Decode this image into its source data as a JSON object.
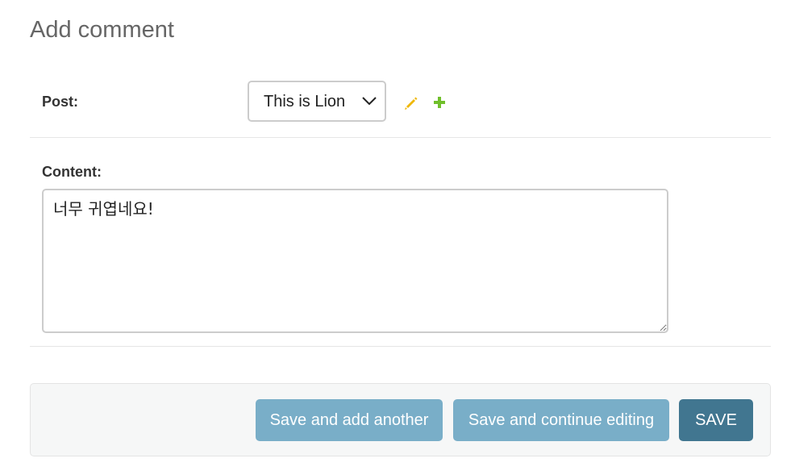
{
  "page": {
    "title": "Add comment"
  },
  "form": {
    "post": {
      "label": "Post:",
      "selected": "This is Lion",
      "edit_icon": "pencil-icon",
      "add_icon": "plus-icon"
    },
    "content": {
      "label": "Content:",
      "value": "너무 귀엽네요!"
    }
  },
  "submit_row": {
    "save_add_another_label": "Save and add another",
    "save_continue_label": "Save and continue editing",
    "save_label": "SAVE"
  },
  "colors": {
    "secondary_button": "#79aec8",
    "primary_button": "#417690",
    "edit_icon": "#efb80b",
    "add_icon": "#70bf2b"
  }
}
